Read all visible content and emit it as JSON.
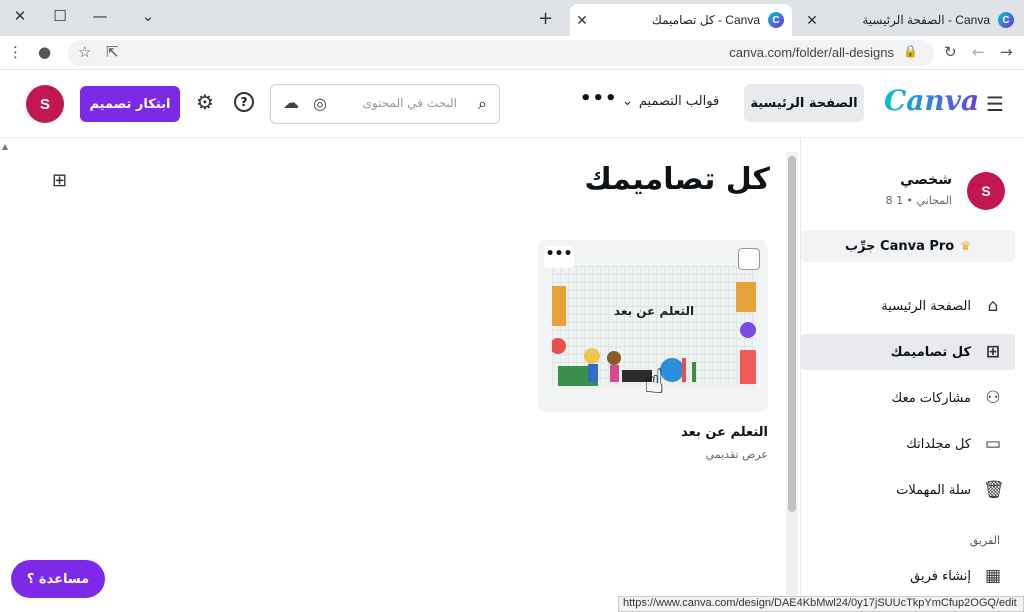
{
  "browser": {
    "tabs": [
      {
        "label": "الصفحة الرئيسية - Canva",
        "favicon": "C"
      },
      {
        "label": "كل تصاميمك - Canva",
        "favicon": "C"
      }
    ],
    "new_tab": "+",
    "url": "canva.com/folder/all-designs",
    "status_url": "https://www.canva.com/design/DAE4KbMwl24/0y17jSUUcTkpYmCfup2OGQ/edit"
  },
  "header": {
    "logo": "Canva",
    "home_label": "الصفحة الرئيسية",
    "templates_label": "قوالب التصميم",
    "more_label": "•••",
    "search_placeholder": "البحث في المحتوى",
    "create_label": "ابتكار تصميم",
    "help_icon_glyph": "?",
    "avatar_letter": "S"
  },
  "sidebar": {
    "avatar_letter": "S",
    "name": "شخصي",
    "plan": "المجاني • 1 8",
    "pro_label": "جرِّب Canva Pro",
    "items": [
      {
        "label": "الصفحة الرئيسية",
        "icon": "home-icon"
      },
      {
        "label": "كل تصاميمك",
        "icon": "grid-icon"
      },
      {
        "label": "مشاركات معك",
        "icon": "users-icon"
      },
      {
        "label": "كل مجلداتك",
        "icon": "folder-icon"
      },
      {
        "label": "سلة المهملات",
        "icon": "trash-icon"
      }
    ],
    "team_section": "الفريق",
    "team_create": "إنشاء فريق"
  },
  "main": {
    "title": "كل تصاميمك",
    "design": {
      "thumbnail_text": "التعلم عن بعد",
      "title": "التعلم عن بعد",
      "type": "عرض تقديمي"
    },
    "help_button": "مساعدة ؟"
  },
  "colors": {
    "accent": "#7d2ae8",
    "avatar": "#c3174f"
  }
}
